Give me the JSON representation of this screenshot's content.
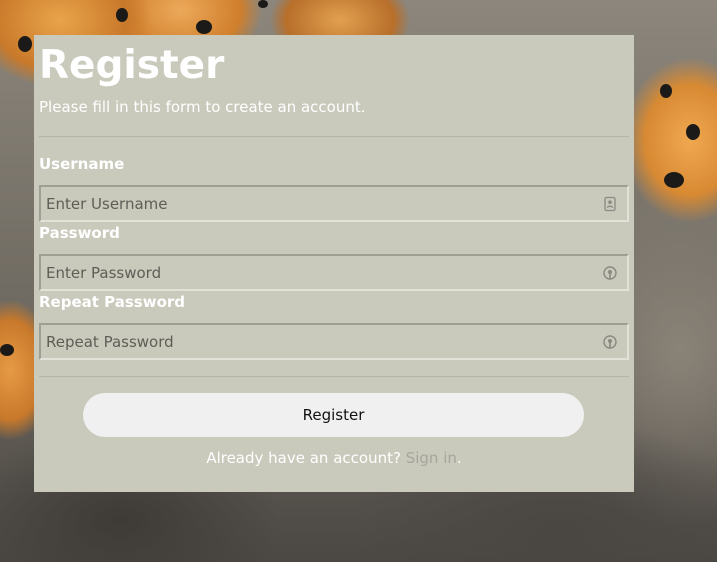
{
  "form": {
    "title": "Register",
    "subtitle": "Please fill in this form to create an account.",
    "username": {
      "label": "Username",
      "placeholder": "Enter Username",
      "icon": "id-badge-icon"
    },
    "password": {
      "label": "Password",
      "placeholder": "Enter Password",
      "icon": "lock-icon"
    },
    "repeat_password": {
      "label": "Repeat Password",
      "placeholder": "Repeat Password",
      "icon": "lock-icon"
    },
    "submit_label": "Register",
    "signin_prompt": "Already have an account?",
    "signin_link": "Sign in",
    "signin_suffix": "."
  },
  "colors": {
    "card_background": "#c9c9bc",
    "button_background": "#f0f0f0",
    "link": "#a6a69d",
    "text": "#ffffff"
  }
}
